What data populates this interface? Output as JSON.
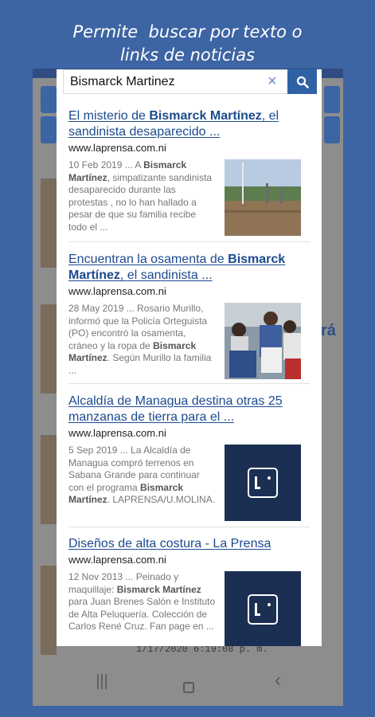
{
  "headline": {
    "line1": "Permite  buscar por texto o",
    "line2": "links de noticias"
  },
  "search": {
    "value": "Bismarck Martinez",
    "placeholder": ""
  },
  "results": [
    {
      "title_parts": [
        "El misterio de ",
        "Bismarck Martínez",
        ", el sandinista desaparecido ..."
      ],
      "url": "www.laprensa.com.ni",
      "snippet_parts": [
        "10 Feb 2019 ... A ",
        "Bismarck Martínez",
        ", simpatizante sandinista desaparecido durante las protestas , no lo han hallado a pesar de que su familia recibe todo el ..."
      ]
    },
    {
      "title_parts": [
        "Encuentran la osamenta de ",
        "Bismarck Martínez",
        ", el sandinista ..."
      ],
      "url": "www.laprensa.com.ni",
      "snippet_parts": [
        "28 May 2019 ... Rosario Murillo, informó que la Policía Orteguista (PO) encontró la osamenta, cráneo y la ropa de ",
        "Bismarck Martínez",
        ". Según Murillo la familia ..."
      ]
    },
    {
      "title_parts": [
        "Alcaldía de Managua destina otras 25 manzanas de tierra para el ...",
        "",
        ""
      ],
      "url": "www.laprensa.com.ni",
      "snippet_parts": [
        "5 Sep 2019 ... La Alcaldía de Managua compró terrenos en Sabana Grande para continuar con el programa ",
        "Bismarck Martínez",
        ". LAPRENSA/U.MOLINA."
      ]
    },
    {
      "title_parts": [
        "Diseños de alta costura - La Prensa",
        "",
        ""
      ],
      "url": "www.laprensa.com.ni",
      "snippet_parts": [
        "12 Nov 2013 ... Peinado y maquillaje: ",
        "Bismarck Martínez",
        " para Juan Brenes Salón e Instituto de Alta Peluquería. Colección de Carlos René Cruz. Fan page en ..."
      ]
    }
  ],
  "background": {
    "date_text": "1/17/2020 6:19:08 p. m.",
    "side_text": "rá"
  },
  "colors": {
    "background": "#3d64a3",
    "link": "#1c4a8e",
    "search_button": "#2f62a5"
  },
  "icons": {
    "search": "search-icon",
    "clear": "clear-icon",
    "back": "back-icon",
    "home": "home-icon",
    "recents": "recents-icon"
  },
  "nav": {
    "recents_glyph": "|||",
    "back_glyph": "‹"
  }
}
